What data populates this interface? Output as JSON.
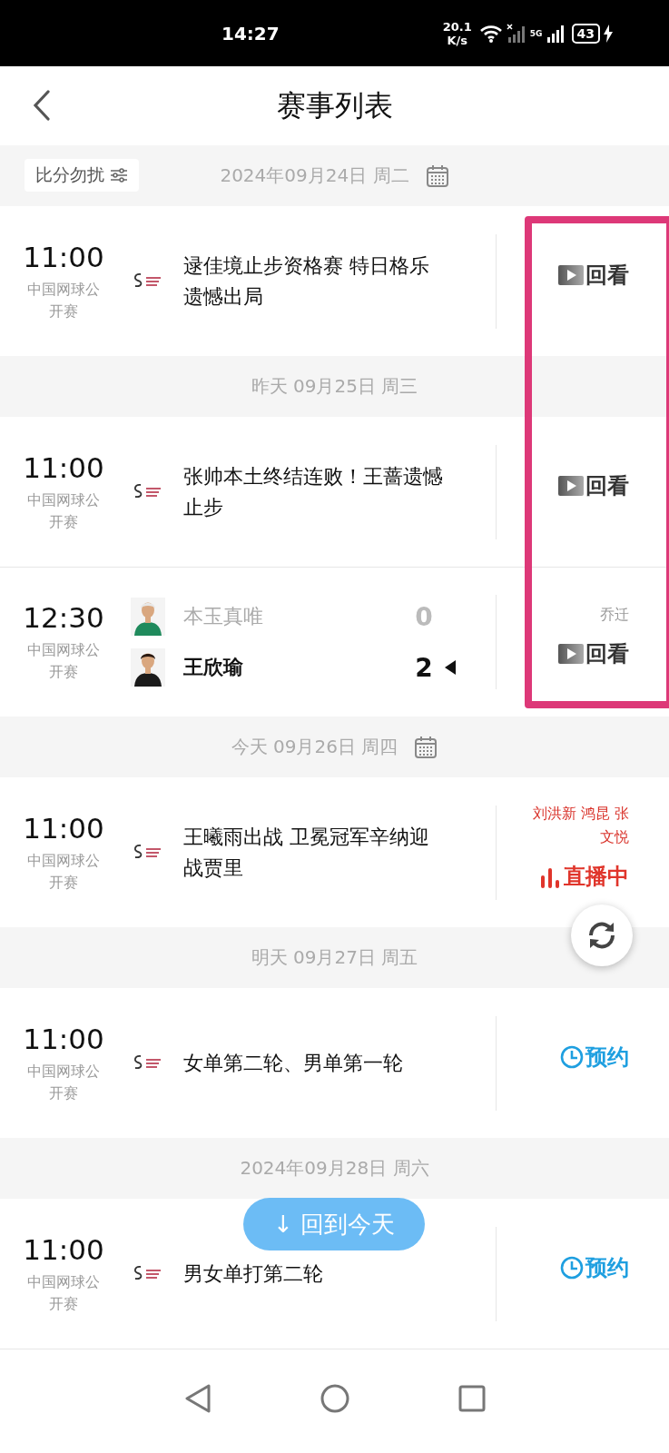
{
  "status_bar": {
    "time": "14:27",
    "speed_value": "20.1",
    "speed_unit": "K/s",
    "network": "5G",
    "battery": "43",
    "charging": true
  },
  "header": {
    "title": "赛事列表"
  },
  "filter": {
    "label": "比分勿扰"
  },
  "sections": [
    {
      "date": "2024年09月24日 周二",
      "calendar_icon": true,
      "matches": [
        {
          "kind": "event",
          "time": "11:00",
          "league": "中国网球公开赛",
          "title": "逯佳境止步资格赛 特日格乐遗憾出局",
          "status": {
            "kind": "replay",
            "label": "回看"
          }
        }
      ]
    },
    {
      "date": "昨天 09月25日 周三",
      "calendar_icon": false,
      "matches": [
        {
          "kind": "event",
          "time": "11:00",
          "league": "中国网球公开赛",
          "title": "张帅本土终结连败！王蔷遗憾止步",
          "status": {
            "kind": "replay",
            "label": "回看"
          }
        },
        {
          "kind": "versus",
          "time": "12:30",
          "league": "中国网球公开赛",
          "players": [
            {
              "name": "本玉真唯",
              "score": "0",
              "winner": false
            },
            {
              "name": "王欣瑜",
              "score": "2",
              "winner": true
            }
          ],
          "commentators": "乔迁",
          "status": {
            "kind": "replay",
            "label": "回看"
          }
        }
      ]
    },
    {
      "date": "今天 09月26日 周四",
      "calendar_icon": true,
      "matches": [
        {
          "kind": "event",
          "time": "11:00",
          "league": "中国网球公开赛",
          "title": "王曦雨出战 卫冕冠军辛纳迎战贾里",
          "commentators": "刘洪新 鸿昆 张文悦",
          "status": {
            "kind": "live",
            "label": "直播中"
          }
        }
      ]
    },
    {
      "date": "明天 09月27日 周五",
      "calendar_icon": false,
      "matches": [
        {
          "kind": "event",
          "time": "11:00",
          "league": "中国网球公开赛",
          "title": "女单第二轮、男单第一轮",
          "status": {
            "kind": "reserve",
            "label": "预约"
          }
        }
      ]
    },
    {
      "date": "2024年09月28日 周六",
      "calendar_icon": false,
      "matches": [
        {
          "kind": "event",
          "time": "11:00",
          "league": "中国网球公开赛",
          "title": "男女单打第二轮",
          "status": {
            "kind": "reserve",
            "label": "预约"
          }
        }
      ]
    }
  ],
  "back_to_today": {
    "label": "↓ 回到今天"
  }
}
